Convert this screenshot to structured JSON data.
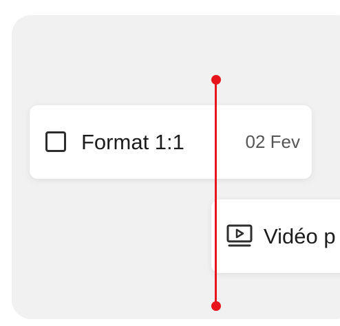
{
  "timeline": {
    "items": [
      {
        "type": "task",
        "label": "Format 1:1",
        "date": "02 Fev",
        "checked": false
      },
      {
        "type": "video",
        "label": "Vidéo p",
        "icon": "video-play-icon"
      }
    ],
    "playhead": {
      "color": "#e8141c"
    }
  },
  "colors": {
    "canvas": "#f1f1f1",
    "card": "#ffffff",
    "accent": "#e8141c"
  }
}
